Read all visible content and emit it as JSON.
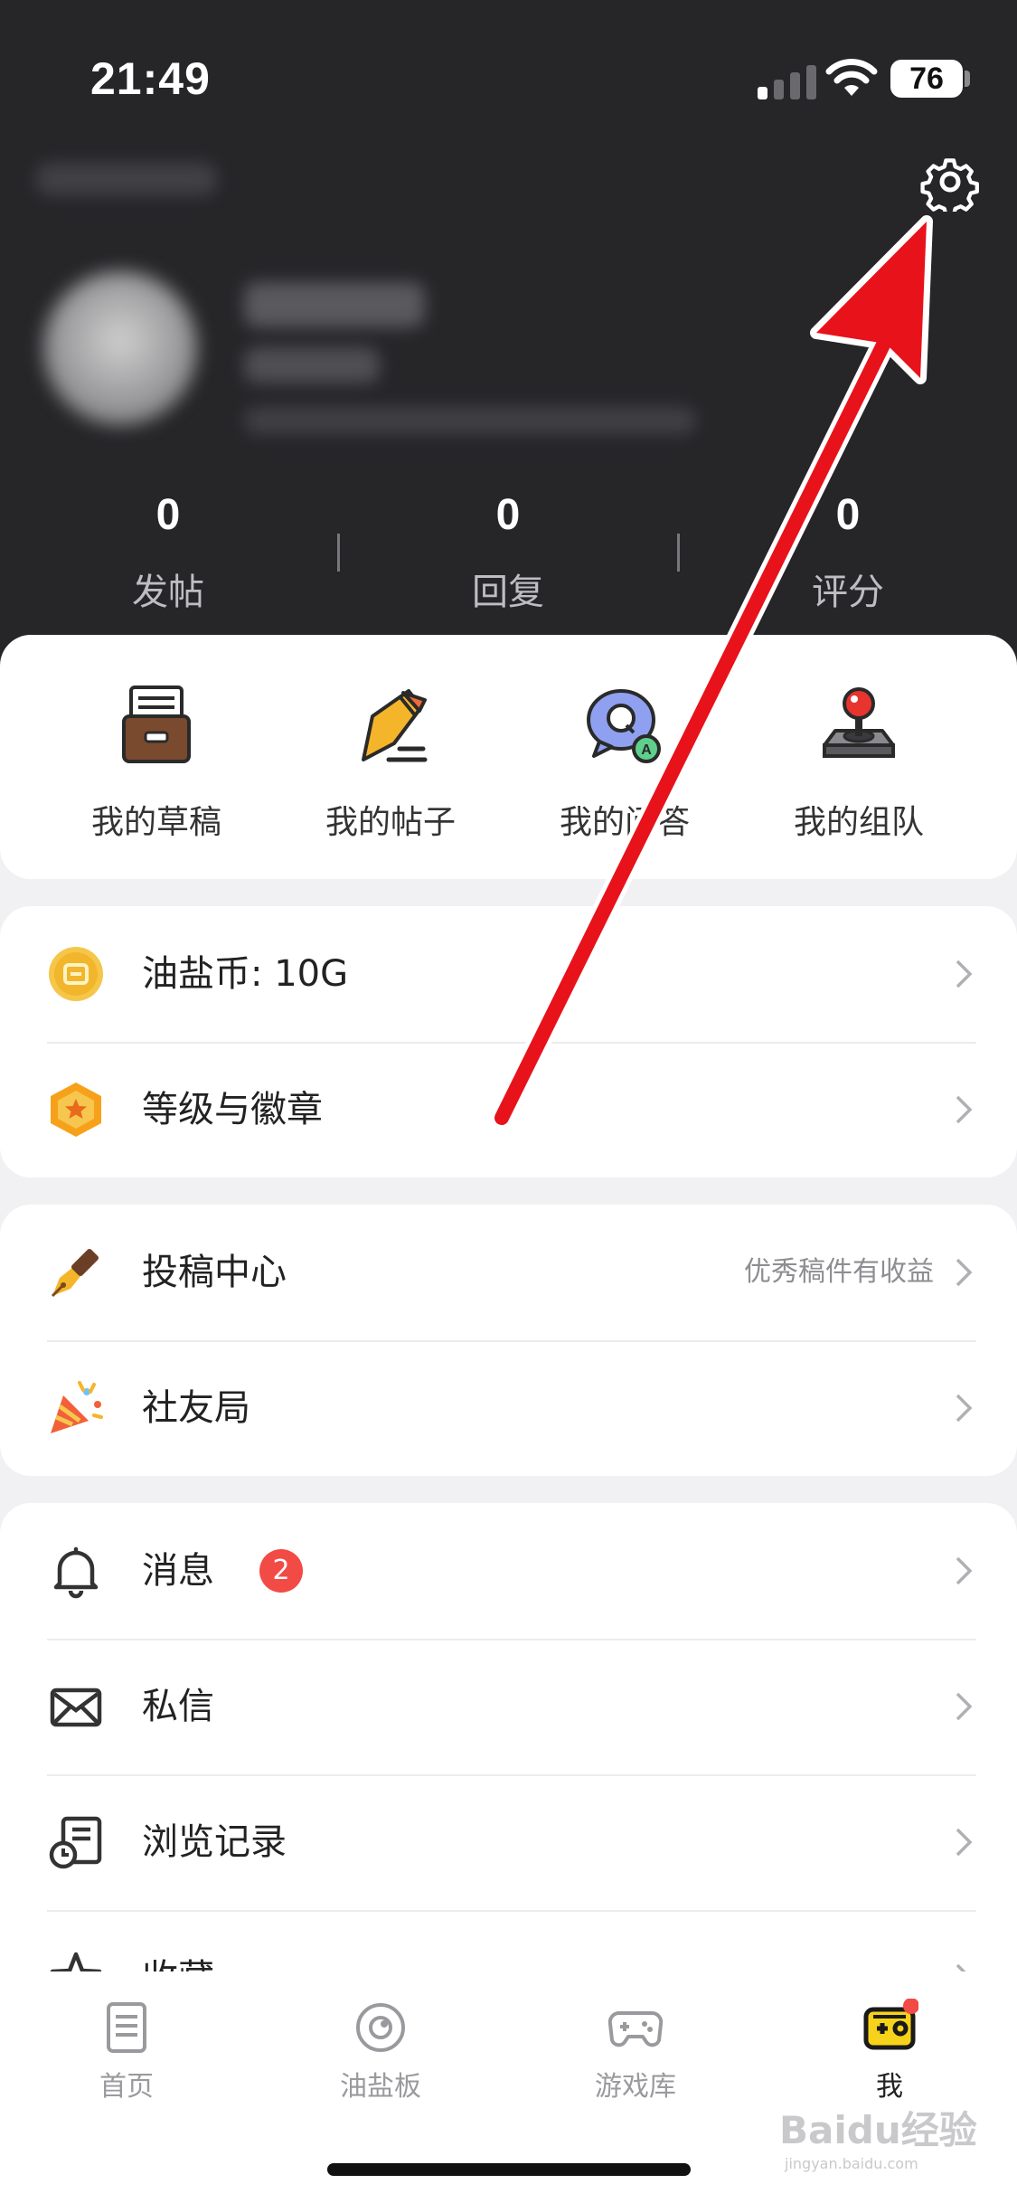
{
  "status_bar": {
    "time": "21:49",
    "battery": "76"
  },
  "stats": [
    {
      "value": "0",
      "label": "发帖"
    },
    {
      "value": "0",
      "label": "回复"
    },
    {
      "value": "0",
      "label": "评分"
    }
  ],
  "quick_actions": [
    {
      "label": "我的草稿",
      "icon": "drafts-box-icon"
    },
    {
      "label": "我的帖子",
      "icon": "pen-post-icon"
    },
    {
      "label": "我的问答",
      "icon": "qa-bubble-icon"
    },
    {
      "label": "我的组队",
      "icon": "joystick-icon"
    }
  ],
  "group1": [
    {
      "label": "油盐币: 10G",
      "icon": "coin-icon"
    },
    {
      "label": "等级与徽章",
      "icon": "badge-icon"
    }
  ],
  "group2": [
    {
      "label": "投稿中心",
      "hint": "优秀稿件有收益",
      "icon": "fountain-pen-icon"
    },
    {
      "label": "社友局",
      "icon": "party-popper-icon"
    }
  ],
  "group3": [
    {
      "label": "消息",
      "badge": "2",
      "icon": "bell-icon"
    },
    {
      "label": "私信",
      "icon": "mail-icon"
    },
    {
      "label": "浏览记录",
      "icon": "history-icon"
    },
    {
      "label": "收藏",
      "icon": "star-icon"
    }
  ],
  "tabs": [
    {
      "label": "首页",
      "icon": "document-icon"
    },
    {
      "label": "油盐板",
      "icon": "board-icon"
    },
    {
      "label": "游戏库",
      "icon": "gamepad-icon"
    },
    {
      "label": "我",
      "icon": "me-icon",
      "active": true
    }
  ],
  "watermark": {
    "main": "Baidu经验",
    "sub": "jingyan.baidu.com"
  },
  "colors": {
    "header_bg": "#262629",
    "accent_red": "#f24a45",
    "annotation_arrow": "#e8121b"
  }
}
